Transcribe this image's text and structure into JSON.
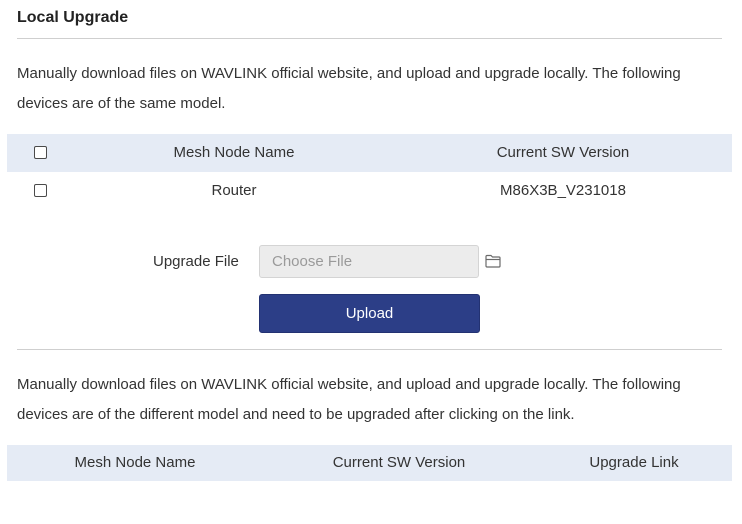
{
  "section": {
    "title": "Local Upgrade"
  },
  "same_model": {
    "description": "Manually download files on WAVLINK official website, and upload and upgrade locally. The following devices are of the same model.",
    "columns": {
      "name": "Mesh Node Name",
      "version": "Current SW Version"
    },
    "rows": [
      {
        "name": "Router",
        "version": "M86X3B_V231018",
        "checked": false
      }
    ],
    "header_checked": false
  },
  "upgrade": {
    "label": "Upgrade File",
    "file_placeholder": "Choose File",
    "upload_label": "Upload",
    "folder_icon": "folder-icon"
  },
  "different_model": {
    "description": "Manually download files on WAVLINK official website, and upload and upgrade locally. The following devices are of the different model and need to be upgraded after clicking on the link.",
    "columns": {
      "name": "Mesh Node Name",
      "version": "Current SW Version",
      "link": "Upgrade Link"
    },
    "rows": []
  },
  "colors": {
    "accent": "#2c3e87",
    "table_header_bg": "#e5ebf5",
    "divider": "#cfcfcf"
  }
}
